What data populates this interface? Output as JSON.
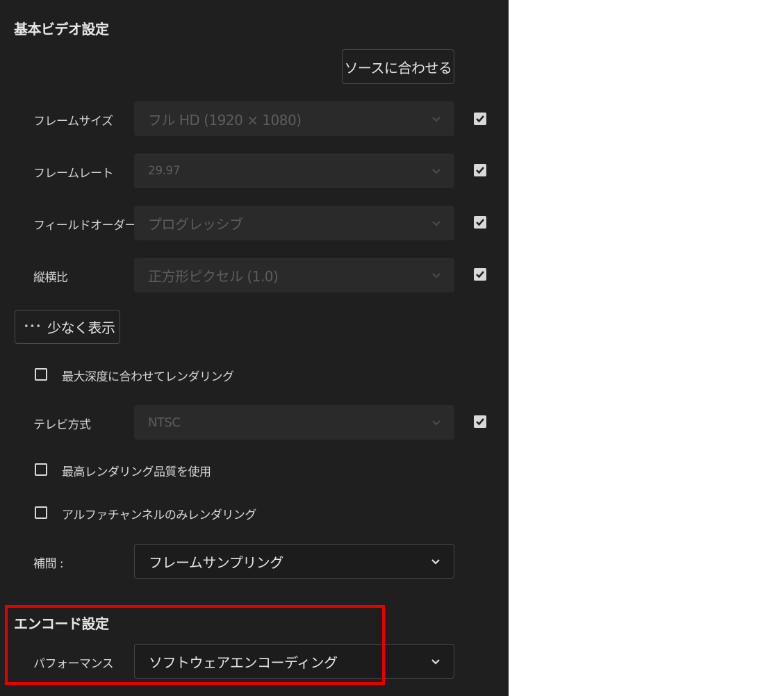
{
  "basic_video": {
    "title": "基本ビデオ設定",
    "match_source_button": "ソースに合わせる",
    "frame_size": {
      "label": "フレームサイズ",
      "value": "フル HD (1920 × 1080)",
      "checked": true
    },
    "frame_rate": {
      "label": "フレームレート",
      "value": "29.97",
      "checked": true
    },
    "field_order": {
      "label": "フィールドオーダー",
      "value": "プログレッシブ",
      "checked": true
    },
    "aspect": {
      "label": "縦横比",
      "value": "正方形ピクセル (1.0)",
      "checked": true
    },
    "show_less_button": "少なく表示",
    "show_less_dots": "•••",
    "max_depth": {
      "label": "最大深度に合わせてレンダリング",
      "checked": false
    },
    "tv_standard": {
      "label": "テレビ方式",
      "value": "NTSC",
      "checked": true
    },
    "max_quality": {
      "label": "最高レンダリング品質を使用",
      "checked": false
    },
    "alpha_only": {
      "label": "アルファチャンネルのみレンダリング",
      "checked": false
    },
    "interpolation": {
      "label": "補間 :",
      "value": "フレームサンプリング"
    }
  },
  "encode": {
    "title": "エンコード設定",
    "performance": {
      "label": "パフォーマンス",
      "value": "ソフトウェアエンコーディング"
    }
  },
  "colors": {
    "panel_bg": "#1f1f1f",
    "highlight": "#e60000"
  }
}
